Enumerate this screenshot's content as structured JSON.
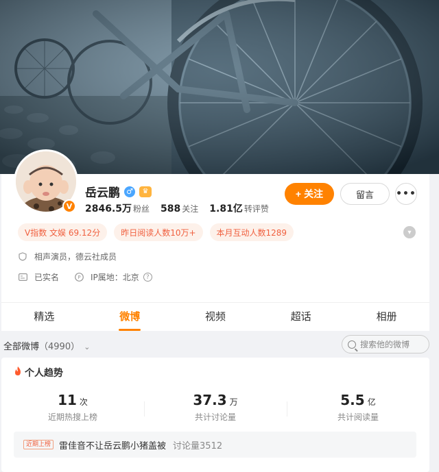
{
  "profile": {
    "name": "岳云鹏",
    "gender_symbol": "♂",
    "verified_mark": "V",
    "stats": [
      {
        "value": "2846.5万",
        "label": "粉丝"
      },
      {
        "value": "588",
        "label": "关注"
      },
      {
        "value": "1.81亿",
        "label": "转评赞"
      }
    ],
    "follow_label": "关注",
    "follow_plus": "+",
    "message_label": "留言",
    "more_label": "•••",
    "tags": [
      "V指数 文娱 69.12分",
      "昨日阅读人数10万+",
      "本月互动人数1289"
    ],
    "bio": "相声演员，德云社成员",
    "real_name": "已实名",
    "ip": "IP属地：北京",
    "help_mark": "?"
  },
  "tabs": [
    {
      "label": "精选",
      "active": false
    },
    {
      "label": "微博",
      "active": true
    },
    {
      "label": "视频",
      "active": false
    },
    {
      "label": "超话",
      "active": false
    },
    {
      "label": "相册",
      "active": false
    }
  ],
  "filter": {
    "label": "全部微博",
    "count": "（4990）",
    "search_placeholder": "搜索他的微博"
  },
  "trend": {
    "title": "个人趋势",
    "metrics": [
      {
        "value": "11",
        "unit": "次",
        "label": "近期热搜上榜"
      },
      {
        "value": "37.3",
        "unit": "万",
        "label": "共计讨论量"
      },
      {
        "value": "5.5",
        "unit": "亿",
        "label": "共计阅读量"
      }
    ],
    "hot_badge": "近期上榜",
    "hot_topic": "雷佳音不让岳云鹏小猪盖被",
    "hot_count": "讨论量3512"
  },
  "colors": {
    "accent": "#ff8200",
    "tag_text": "#f0603f",
    "tag_bg": "#fdf1ea"
  }
}
